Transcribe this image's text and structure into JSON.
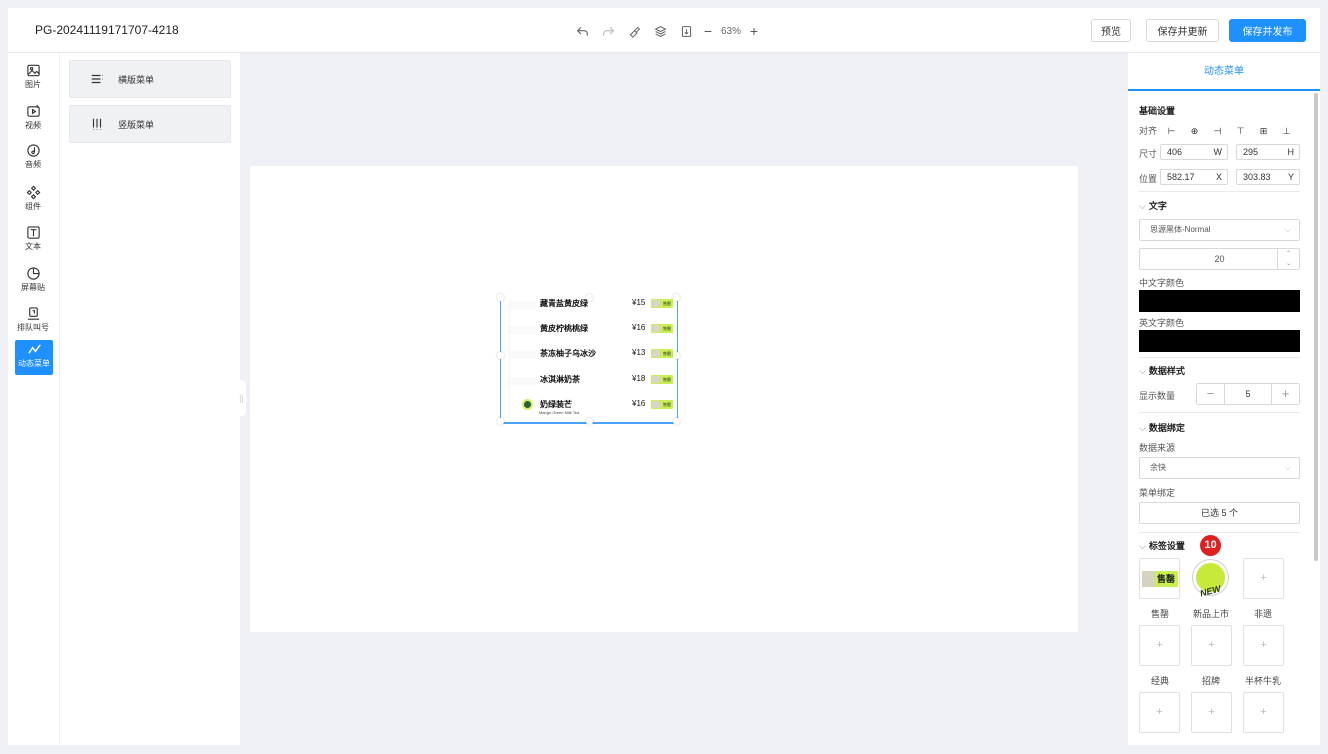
{
  "header": {
    "project_id": "PG-20241119171707-4218",
    "zoom": "63%",
    "zoom_minus": "−",
    "zoom_plus": "+",
    "preview_label": "预览",
    "save_update_label": "保存并更新",
    "save_publish_label": "保存并发布",
    "accent_color": "#1e90ff"
  },
  "rail": {
    "items": [
      {
        "label": "图片",
        "icon": "image-icon"
      },
      {
        "label": "视频",
        "icon": "video-icon"
      },
      {
        "label": "音频",
        "icon": "audio-icon"
      },
      {
        "label": "组件",
        "icon": "component-icon"
      },
      {
        "label": "文本",
        "icon": "text-icon"
      },
      {
        "label": "屏幕贴",
        "icon": "sticker-icon"
      },
      {
        "label": "排队叫号",
        "icon": "queue-icon"
      },
      {
        "label": "动态菜单",
        "icon": "dynamic-menu-icon",
        "active": true
      }
    ]
  },
  "components": {
    "items": [
      {
        "label": "横版菜单",
        "icon": "horizontal-menu-icon"
      },
      {
        "label": "竖版菜单",
        "icon": "vertical-menu-icon"
      }
    ]
  },
  "canvas": {
    "menu_rows": [
      {
        "name": "藏青盐黄皮绿",
        "price": "¥15",
        "tag": "售罄"
      },
      {
        "name": "黄皮柠桃桃绿",
        "price": "¥16",
        "tag": "售罄"
      },
      {
        "name": "茶冻柚子乌冰沙",
        "price": "¥13",
        "tag": "售罄"
      },
      {
        "name": "冰淇淋奶茶",
        "price": "¥18",
        "tag": "售罄"
      },
      {
        "name": "奶绿装芒",
        "subtitle": "Mango Green Milk Tea",
        "price": "¥16",
        "tag": "售罄"
      }
    ]
  },
  "panel": {
    "tab": "动态菜单",
    "basic": {
      "title": "基础设置",
      "align_label": "对齐",
      "align_icons": [
        "⊢",
        "⊕",
        "⊣",
        "⊤",
        "⊞",
        "⊥"
      ],
      "size_label": "尺寸",
      "width": "406",
      "width_suffix": "W",
      "height": "295",
      "height_suffix": "H",
      "pos_label": "位置",
      "x": "582.17",
      "x_suffix": "X",
      "y": "303.83",
      "y_suffix": "Y"
    },
    "text": {
      "title": "文字",
      "font": "思源黑体-Normal",
      "font_size": "20",
      "cn_color_label": "中文字颜色",
      "en_color_label": "英文字颜色",
      "cn_color": "#000000",
      "en_color": "#000000"
    },
    "data_style": {
      "title": "数据样式",
      "count_label": "显示数量",
      "count": "5",
      "minus": "−",
      "plus": "+"
    },
    "data_bind": {
      "title": "数据绑定",
      "source_label": "数据来源",
      "source": "余快",
      "menu_bind_label": "菜单绑定",
      "selected": "已选 5 个"
    },
    "tags": {
      "title": "标签设置",
      "badge": "10",
      "items": [
        {
          "label": "售罄",
          "has_image": true
        },
        {
          "label": "新品上市",
          "has_image": true
        },
        {
          "label": "非遗",
          "has_image": false
        },
        {
          "label": "经典",
          "has_image": false
        },
        {
          "label": "招牌",
          "has_image": false
        },
        {
          "label": "半杯牛乳",
          "has_image": false
        }
      ],
      "add_symbol": "+",
      "new_text": "NEW",
      "soldout_text": "售罄"
    }
  }
}
